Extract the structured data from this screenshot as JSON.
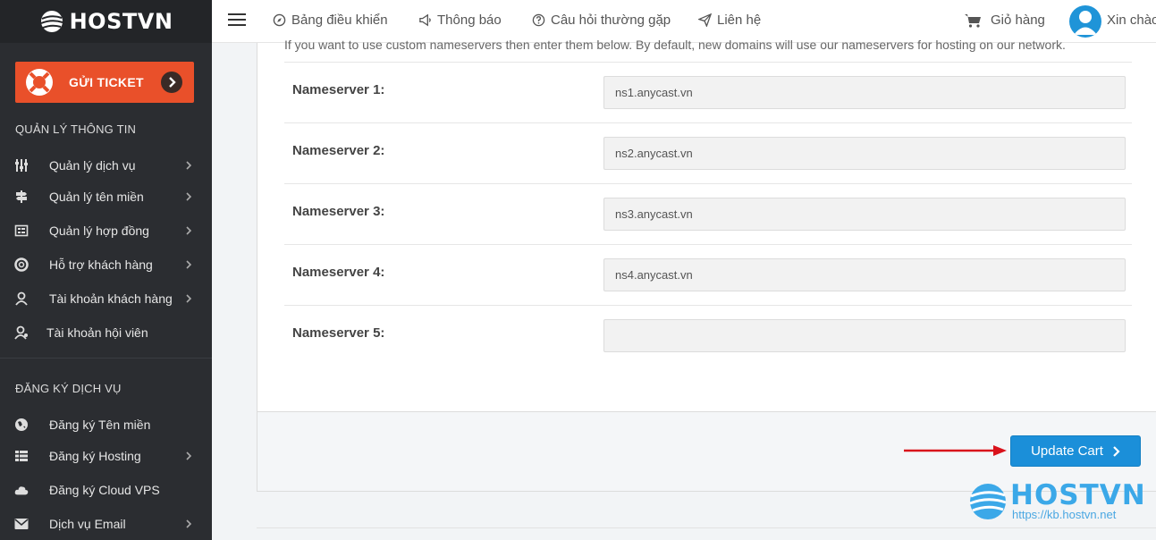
{
  "brand": {
    "name": "HOSTVN"
  },
  "sidebar": {
    "ticket_label": "GỬI TICKET",
    "section1_title": "QUẢN LÝ THÔNG TIN",
    "section2_title": "ĐĂNG KÝ DỊCH VỤ",
    "items": [
      {
        "label": "Quản lý dịch vụ",
        "icon": "sliders-icon"
      },
      {
        "label": "Quản lý tên miền",
        "icon": "signpost-icon"
      },
      {
        "label": "Quản lý hợp đồng",
        "icon": "contract-icon"
      },
      {
        "label": "Hỗ trợ khách hàng",
        "icon": "lifebuoy-icon"
      },
      {
        "label": "Tài khoản khách hàng",
        "icon": "user-icon"
      },
      {
        "label": "Tài khoản hội viên",
        "icon": "member-icon"
      }
    ],
    "register_items": [
      {
        "label": "Đăng ký Tên miền",
        "icon": "globe-icon"
      },
      {
        "label": "Đăng ký Hosting",
        "icon": "grid-icon"
      },
      {
        "label": "Đăng ký Cloud VPS",
        "icon": "cloud-icon"
      },
      {
        "label": "Dịch vụ Email",
        "icon": "envelope-icon"
      }
    ]
  },
  "topbar": {
    "dashboard": "Bảng điều khiển",
    "notifications": "Thông báo",
    "faq": "Câu hỏi thường gặp",
    "contact": "Liên hệ",
    "cart": "Giỏ hàng",
    "greeting": "Xin chào"
  },
  "main": {
    "intro": "If you want to use custom nameservers then enter them below. By default, new domains will use our nameservers for hosting on our network.",
    "nameservers": [
      {
        "label": "Nameserver 1:",
        "value": "ns1.anycast.vn"
      },
      {
        "label": "Nameserver 2:",
        "value": "ns2.anycast.vn"
      },
      {
        "label": "Nameserver 3:",
        "value": "ns3.anycast.vn"
      },
      {
        "label": "Nameserver 4:",
        "value": "ns4.anycast.vn"
      },
      {
        "label": "Nameserver 5:",
        "value": ""
      }
    ],
    "update_cart": "Update Cart"
  },
  "watermark": {
    "text": "HOSTVN",
    "url": "https://kb.hostvn.net"
  },
  "colors": {
    "sidebar": "#2b2d31",
    "ticket": "#e9502a",
    "accent": "#1b8fd9",
    "arrow": "#d9121b"
  }
}
